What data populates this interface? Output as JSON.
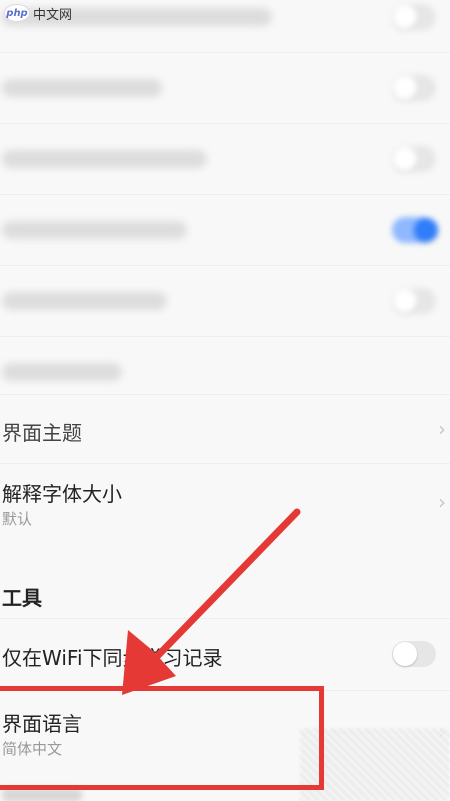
{
  "watermark": {
    "logo": "php",
    "text": "中文网"
  },
  "settings": {
    "theme_label": "界面主题",
    "font_size_label": "解释字体大小",
    "font_size_value": "默认",
    "tools_section": "工具",
    "wifi_sync_label": "仅在WiFi下同步学习记录",
    "language_label": "界面语言",
    "language_value": "简体中文"
  },
  "toggles": {
    "blurred_row_4_on": true,
    "wifi_sync_on": false
  },
  "colors": {
    "accent": "#2f7dfa",
    "annotation": "#e53935"
  },
  "icons": [
    "chevron-right-icon",
    "toggle-switch-icon",
    "arrow-annotation"
  ]
}
